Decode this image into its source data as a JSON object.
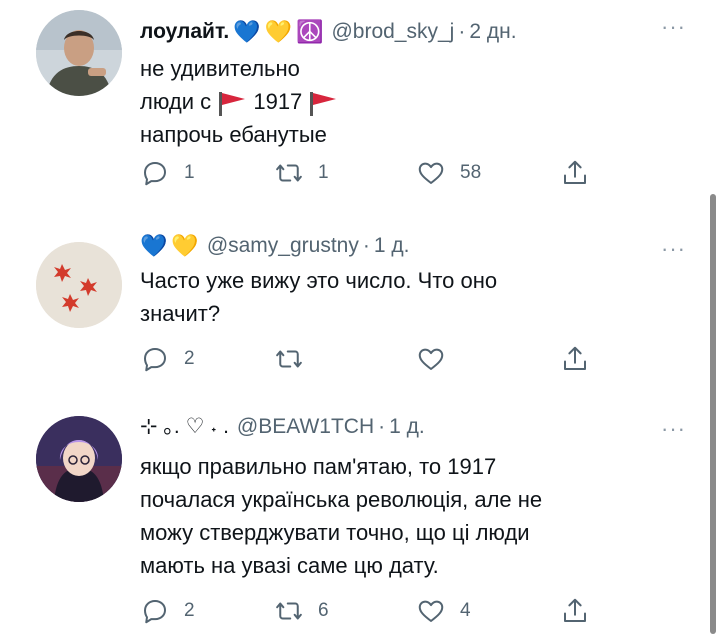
{
  "tweets": [
    {
      "name": "лоулайт.",
      "name_emoji": [
        "💙",
        "💛",
        "☮️"
      ],
      "handle": "@brod_sky_j",
      "time": "2 дн.",
      "text_lines": [
        "не удивительно",
        "люди с",
        "1917",
        "напрочь ебанутые"
      ],
      "replies": "1",
      "retweets": "1",
      "likes": "58"
    },
    {
      "name_emoji": [
        "💙",
        "💛"
      ],
      "handle": "@samy_grustny",
      "time": "1 д.",
      "text_lines": [
        "Часто уже вижу это число. Что оно",
        "значит?"
      ],
      "replies": "2",
      "retweets": "",
      "likes": ""
    },
    {
      "name": "⊹ ｡. ♡ ˖ .",
      "handle": "@BEAW1TCH",
      "time": "1 д.",
      "text_lines": [
        "якщо правильно пам'ятаю, то 1917",
        "почалася українська революція, але не",
        "можу стверджувати точно, що ці люди",
        "мають на увазі саме цю дату."
      ],
      "replies": "2",
      "retweets": "6",
      "likes": "4"
    }
  ],
  "more_label": "···",
  "colors": {
    "text": "#0f1419",
    "secondary": "#536471",
    "flag": "#d7263d"
  },
  "icons": [
    "reply-icon",
    "retweet-icon",
    "like-icon",
    "share-icon",
    "more-icon",
    "red-flag-icon"
  ]
}
